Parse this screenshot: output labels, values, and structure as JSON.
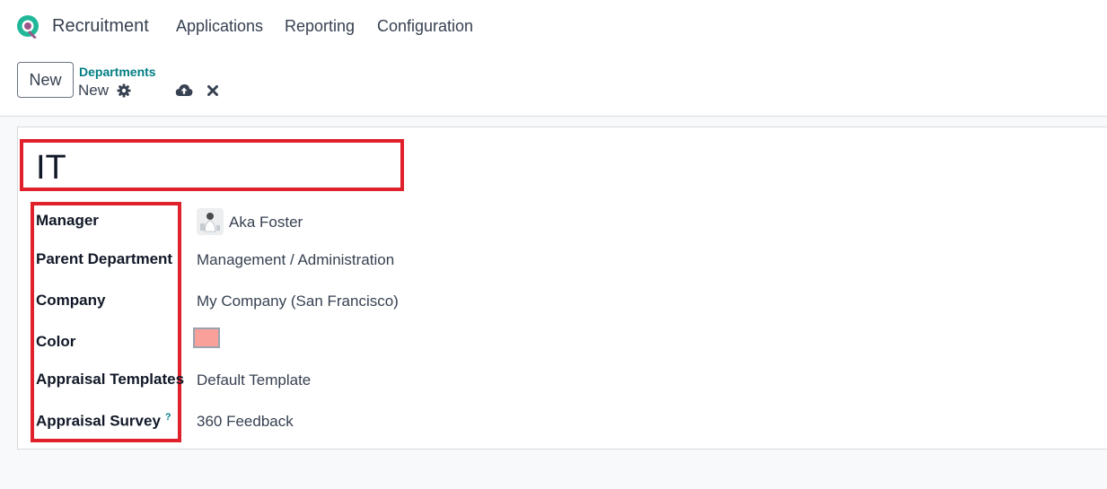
{
  "app": {
    "name": "Recruitment",
    "logo_color": "#21b799"
  },
  "menu": [
    {
      "label": "Applications"
    },
    {
      "label": "Reporting"
    },
    {
      "label": "Configuration"
    }
  ],
  "control": {
    "new_label": "New",
    "breadcrumb_parent": "Departments",
    "breadcrumb_current": "New"
  },
  "form": {
    "department_name": "IT",
    "fields": {
      "manager": {
        "label": "Manager",
        "value": "Aka Foster"
      },
      "parent_department": {
        "label": "Parent Department",
        "value": "Management / Administration"
      },
      "company": {
        "label": "Company",
        "value": "My Company (San Francisco)"
      },
      "color": {
        "label": "Color",
        "value": "#f9a09b"
      },
      "appraisal_templates": {
        "label": "Appraisal Templates",
        "value": "Default Template"
      },
      "appraisal_survey": {
        "label": "Appraisal Survey",
        "help": "?",
        "value": "360 Feedback"
      }
    }
  },
  "colors": {
    "accent": "#017e84",
    "highlight": "#e0212b"
  }
}
